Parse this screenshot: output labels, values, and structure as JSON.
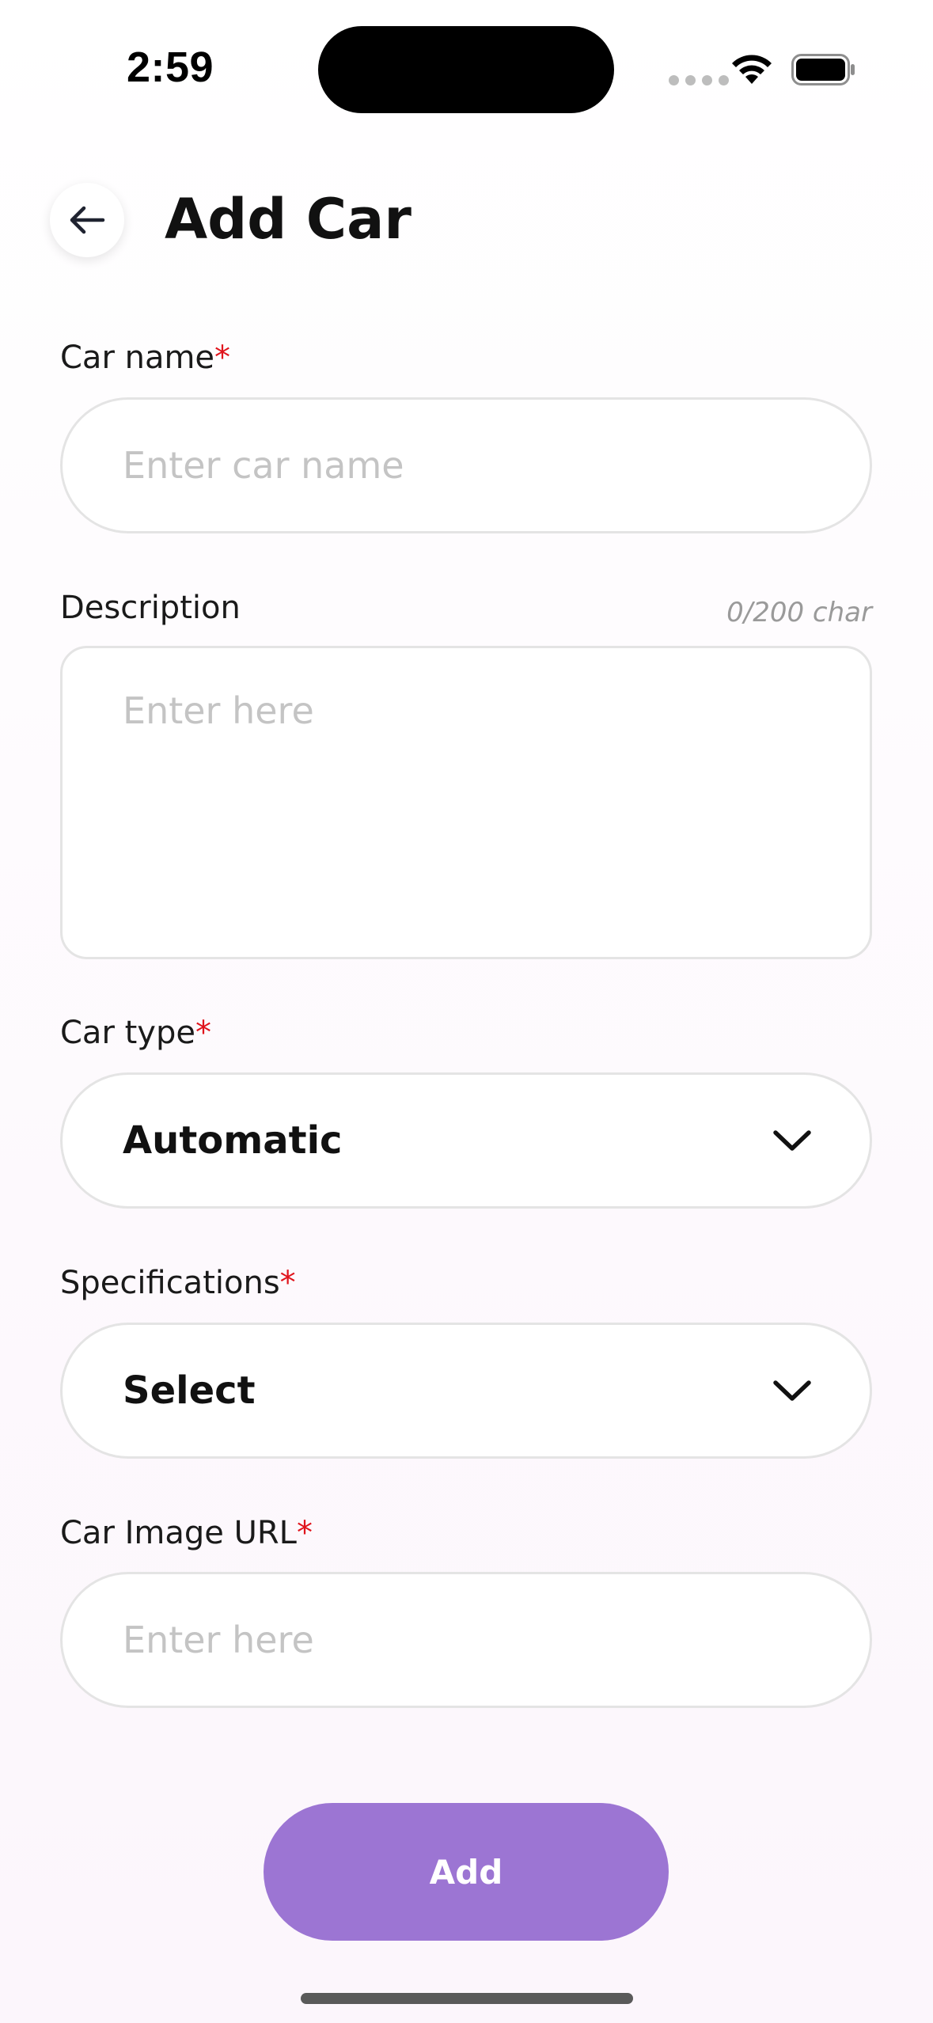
{
  "status_bar": {
    "time": "2:59"
  },
  "header": {
    "title": "Add Car",
    "back_icon": "arrow-left-icon"
  },
  "form": {
    "car_name": {
      "label": "Car name",
      "required_mark": "*",
      "placeholder": "Enter car name",
      "value": ""
    },
    "description": {
      "label": "Description",
      "char_count": "0/200 char",
      "placeholder": "Enter here",
      "value": ""
    },
    "car_type": {
      "label": "Car type",
      "required_mark": "*",
      "selected": "Automatic",
      "icon": "chevron-down-icon"
    },
    "specifications": {
      "label": "Specifications",
      "required_mark": "*",
      "selected": "Select",
      "icon": "chevron-down-icon"
    },
    "image_url": {
      "label": "Car Image URL",
      "required_mark": "*",
      "placeholder": "Enter here",
      "value": ""
    }
  },
  "actions": {
    "add_label": "Add"
  },
  "colors": {
    "accent": "#9c75d3",
    "required": "#e0141c",
    "border": "#e4e4e4",
    "placeholder": "#c4c4c4"
  }
}
